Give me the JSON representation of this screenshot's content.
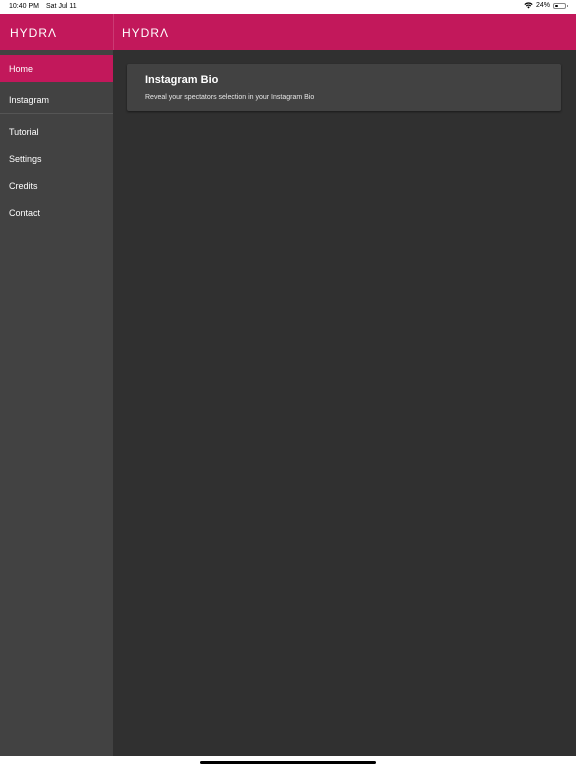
{
  "status_bar": {
    "time": "10:40 PM",
    "date": "Sat Jul 11",
    "battery": "24%",
    "wifi_icon": "wifi-icon",
    "battery_icon": "battery-icon"
  },
  "header": {
    "logo_left": "HYDRΛ",
    "logo_right": "HYDRΛ",
    "brand_color": "#c2185b"
  },
  "sidebar": {
    "items": [
      {
        "label": "Home",
        "active": true
      },
      {
        "label": "Instagram",
        "active": false
      },
      {
        "label": "Tutorial",
        "active": false
      },
      {
        "label": "Settings",
        "active": false
      },
      {
        "label": "Credits",
        "active": false
      },
      {
        "label": "Contact",
        "active": false
      }
    ]
  },
  "main": {
    "card": {
      "title": "Instagram Bio",
      "subtitle": "Reveal your spectators selection in your Instagram Bio"
    }
  },
  "colors": {
    "sidebar_bg": "#424242",
    "main_bg": "#303030",
    "accent": "#c2185b"
  }
}
